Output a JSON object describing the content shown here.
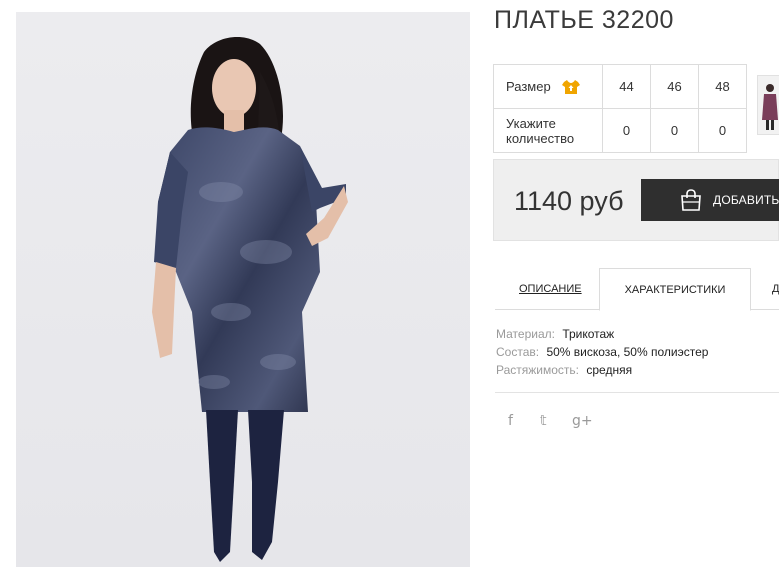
{
  "product": {
    "title": "ПЛАТЬЕ 32200"
  },
  "size_table": {
    "size_label": "Размер",
    "size_icon": "shirt-icon",
    "quantity_label": "Укажите количество",
    "sizes": [
      "44",
      "46",
      "48"
    ],
    "quantities": [
      "0",
      "0",
      "0"
    ]
  },
  "purchase": {
    "price": "1140 руб",
    "add_button_label": "ДОБАВИТЬ В",
    "add_button_icon": "shopping-bag-icon",
    "button_color": "#2f2f2f",
    "accent_color": "#f0a500"
  },
  "tabs": [
    {
      "label": "ОПИСАНИЕ",
      "active": false
    },
    {
      "label": "ХАРАКТЕРИСТИКИ",
      "active": true
    },
    {
      "label": "Д",
      "active": false
    }
  ],
  "specs": [
    {
      "label": "Материал:",
      "value": "Трикотаж"
    },
    {
      "label": "Состав:",
      "value": "50% вискоза, 50% полиэстер"
    },
    {
      "label": "Растяжимость:",
      "value": "средняя"
    }
  ],
  "social": [
    "f",
    "𝕥",
    "g+"
  ]
}
